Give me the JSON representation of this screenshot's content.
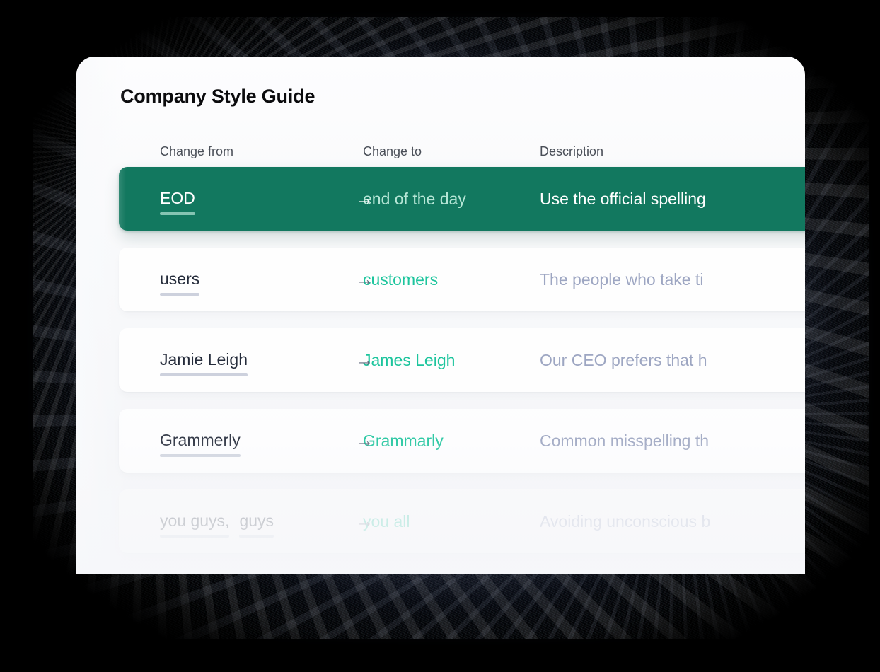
{
  "card": {
    "title": "Company Style Guide"
  },
  "table": {
    "columns": [
      {
        "id": "change-from",
        "label": "Change from"
      },
      {
        "id": "change-to",
        "label": "Change to"
      },
      {
        "id": "description",
        "label": "Description"
      }
    ],
    "arrow_icon": "→",
    "rows": [
      {
        "terms": [
          "EOD"
        ],
        "change_to": "end of the day",
        "description": "Use the official spelling",
        "selected": true
      },
      {
        "terms": [
          "users"
        ],
        "change_to": "customers",
        "description": "The people who take ti",
        "selected": false
      },
      {
        "terms": [
          "Jamie Leigh"
        ],
        "change_to": "James Leigh",
        "description": "Our CEO prefers that h",
        "selected": false
      },
      {
        "terms": [
          "Grammerly"
        ],
        "change_to": "Grammarly",
        "description": "Common misspelling th",
        "selected": false
      },
      {
        "terms": [
          "you guys,",
          "guys"
        ],
        "change_to": "you all",
        "description": "Avoiding unconscious b",
        "selected": false
      }
    ]
  },
  "colors": {
    "accent_green": "#12785f",
    "mint_green": "#15c39a",
    "row_background": "#ffffff",
    "card_background": "#f7f8fa",
    "page_background": "#000000",
    "description_text": "#9aa3c0",
    "term_text": "#1c2333"
  }
}
